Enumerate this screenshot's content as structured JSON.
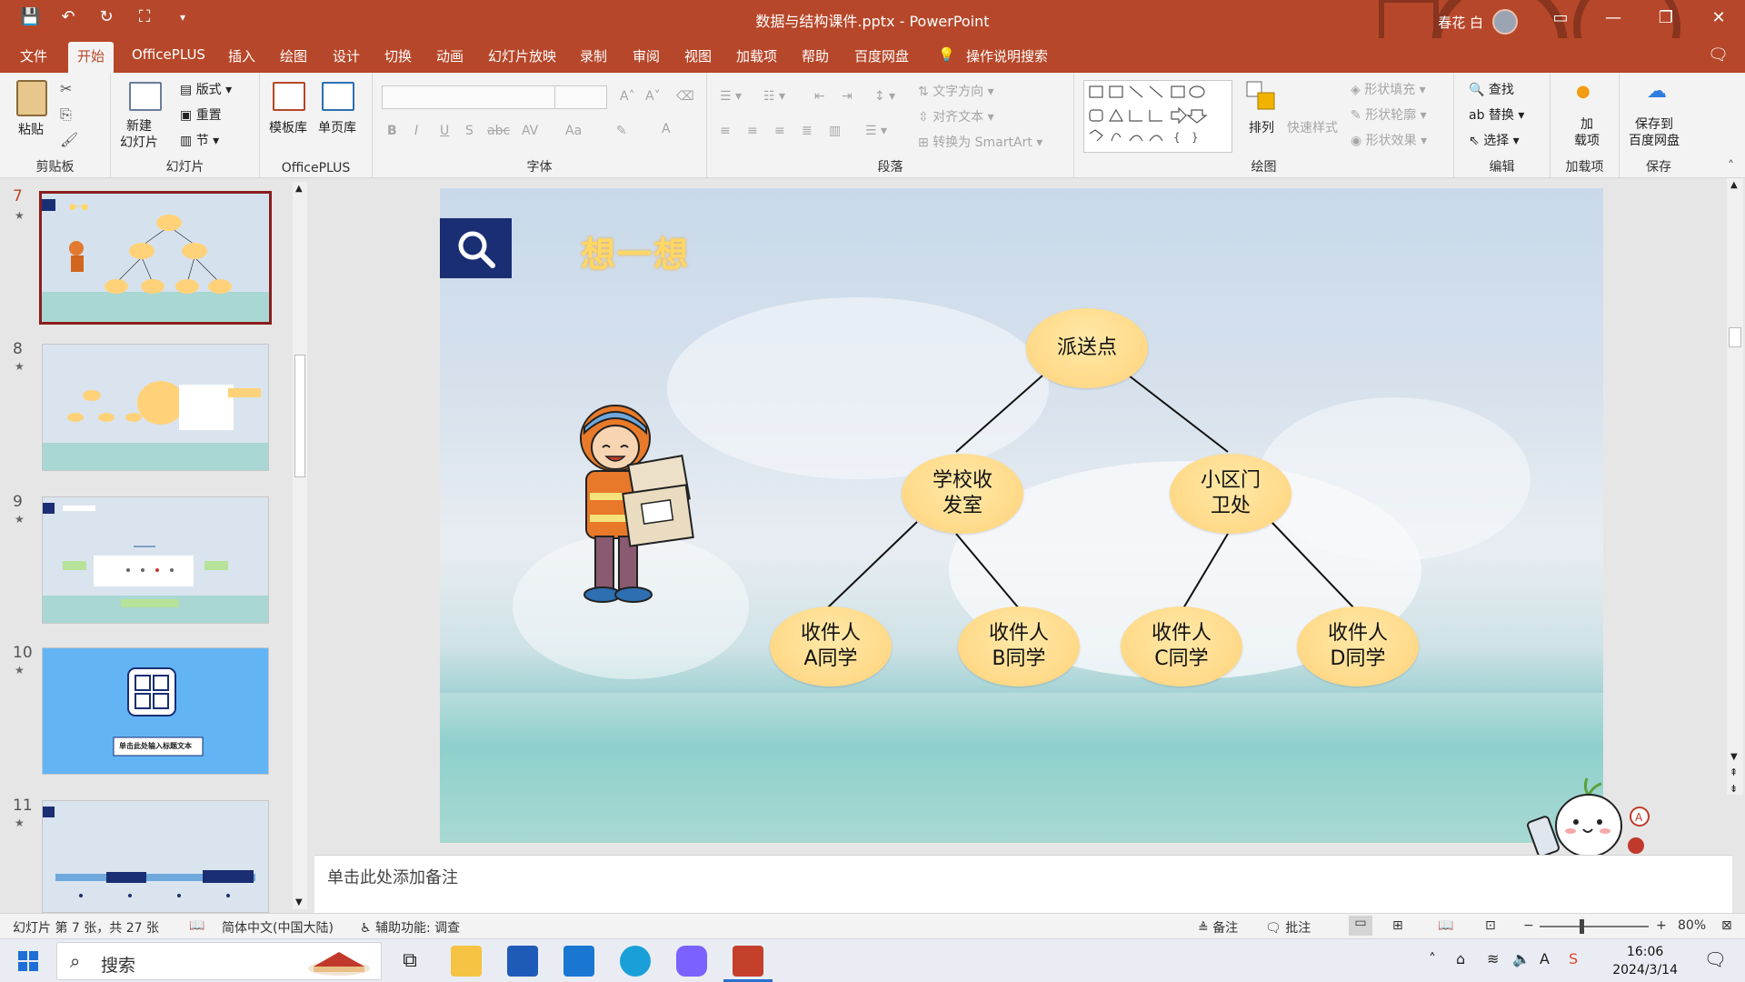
{
  "window": {
    "title": "数据与结构课件.pptx  -  PowerPoint",
    "user_name": "春花 白",
    "controls": [
      "ribbon-display-icon",
      "minimize-icon",
      "restore-icon",
      "close-icon"
    ]
  },
  "quick_access": [
    "save-icon",
    "undo-icon",
    "redo-icon",
    "present-icon",
    "customize-icon"
  ],
  "tabs": [
    {
      "label": "文件"
    },
    {
      "label": "开始",
      "active": true
    },
    {
      "label": "OfficePLUS"
    },
    {
      "label": "插入"
    },
    {
      "label": "绘图"
    },
    {
      "label": "设计"
    },
    {
      "label": "切换"
    },
    {
      "label": "动画"
    },
    {
      "label": "幻灯片放映"
    },
    {
      "label": "录制"
    },
    {
      "label": "审阅"
    },
    {
      "label": "视图"
    },
    {
      "label": "加载项"
    },
    {
      "label": "帮助"
    },
    {
      "label": "百度网盘"
    },
    {
      "label": "操作说明搜索"
    }
  ],
  "ribbon": {
    "groups": {
      "clipboard": "剪贴板",
      "slides": "幻灯片",
      "officeplus": "OfficePLUS",
      "font": "字体",
      "paragraph": "段落",
      "drawing": "绘图",
      "editing": "编辑",
      "addins": "加载项",
      "save": "保存"
    },
    "paste": "粘贴",
    "new_slide": "新建\n幻灯片",
    "layout": "版式",
    "reset": "重置",
    "section": "节",
    "template_lib": "模板库",
    "single_page_lib": "单页库",
    "text_direction": "文字方向",
    "align_text": "对齐文本",
    "convert_smartart": "转换为 SmartArt",
    "arrange": "排列",
    "quick_styles": "快速样式",
    "shape_fill": "形状填充",
    "shape_outline": "形状轮廓",
    "shape_effects": "形状效果",
    "find": "查找",
    "replace": "替换",
    "select": "选择",
    "addins_btn": "加\n载项",
    "save_baidu": "保存到\n百度网盘",
    "font_buttons": [
      "B",
      "I",
      "U",
      "S",
      "abc",
      "AV",
      "Aa",
      "A"
    ]
  },
  "thumbnails": [
    {
      "num": "7",
      "selected": true
    },
    {
      "num": "8"
    },
    {
      "num": "9"
    },
    {
      "num": "10",
      "caption": "单击此处输入标题文本"
    },
    {
      "num": "11"
    }
  ],
  "slide": {
    "title": "想一想",
    "nodes": {
      "root": "派送点",
      "left": "学校收\n发室",
      "right": "小区门\n卫处",
      "a": "收件人\nA同学",
      "b": "收件人\nB同学",
      "c": "收件人\nC同学",
      "d": "收件人\nD同学"
    }
  },
  "notes_placeholder": "单击此处添加备注",
  "status": {
    "slide_info": "幻灯片 第 7 张，共 27 张",
    "language": "简体中文(中国大陆)",
    "accessibility": "辅助功能: 调查",
    "notes_btn": "备注",
    "comments_btn": "批注",
    "zoom": "80%"
  },
  "taskbar": {
    "search_label": "搜索",
    "time": "16:06",
    "date": "2024/3/14"
  },
  "colors": {
    "accent": "#b7472a",
    "node_fill": "#ffd27a",
    "title_yellow": "#ffd764",
    "mag_blue": "#1a2e74"
  }
}
